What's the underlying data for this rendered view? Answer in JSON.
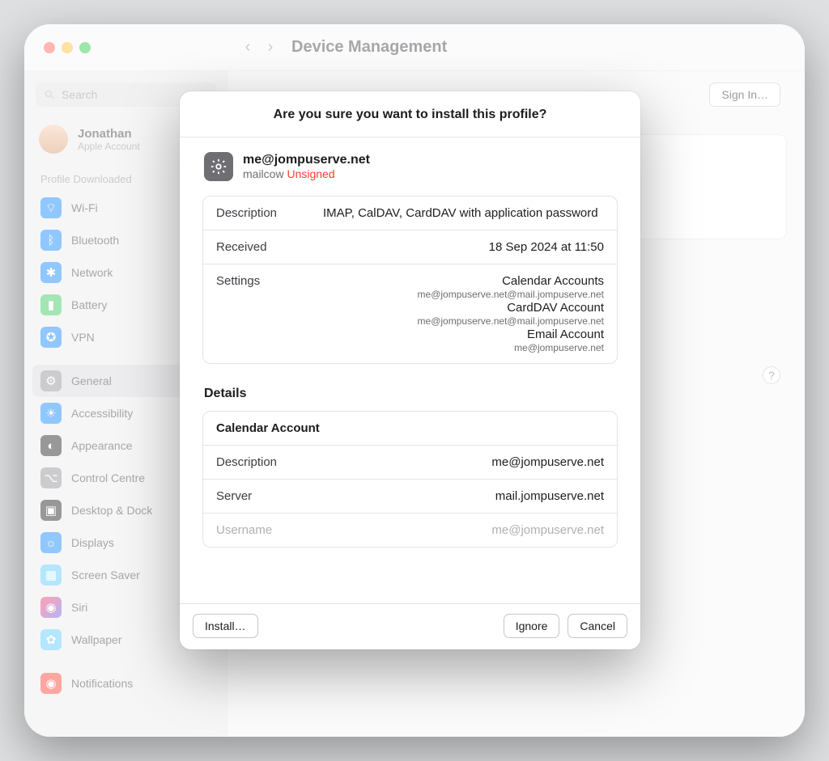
{
  "header": {
    "title": "Device Management",
    "signin": "Sign In…",
    "help": "?"
  },
  "search": {
    "placeholder": "Search"
  },
  "account": {
    "name": "Jonathan",
    "sub": "Apple Account"
  },
  "sidebar": {
    "sectionLabel": "Profile Downloaded",
    "items1": [
      {
        "label": "Wi-Fi",
        "icon": "wifi"
      },
      {
        "label": "Bluetooth",
        "icon": "bt"
      },
      {
        "label": "Network",
        "icon": "net"
      },
      {
        "label": "Battery",
        "icon": "bat"
      },
      {
        "label": "VPN",
        "icon": "vpn"
      }
    ],
    "items2": [
      {
        "label": "General",
        "icon": "gen",
        "selected": true
      },
      {
        "label": "Accessibility",
        "icon": "acc"
      },
      {
        "label": "Appearance",
        "icon": "app"
      },
      {
        "label": "Control Centre",
        "icon": "cc"
      },
      {
        "label": "Desktop & Dock",
        "icon": "dock"
      },
      {
        "label": "Displays",
        "icon": "disp"
      },
      {
        "label": "Screen Saver",
        "icon": "ss"
      },
      {
        "label": "Siri",
        "icon": "siri"
      },
      {
        "label": "Wallpaper",
        "icon": "wall"
      }
    ],
    "items3": [
      {
        "label": "Notifications",
        "icon": "not"
      }
    ]
  },
  "modal": {
    "title": "Are you sure you want to install this profile?",
    "profile": {
      "name": "me@jompuserve.net",
      "source": "mailcow",
      "status": "Unsigned"
    },
    "info": {
      "descriptionLabel": "Description",
      "descriptionValue": "IMAP, CalDAV, CardDAV with application password",
      "receivedLabel": "Received",
      "receivedValue": "18 Sep 2024 at 11:50"
    },
    "settingsLabel": "Settings",
    "settings": [
      {
        "main": "Calendar Accounts",
        "sub": "me@jompuserve.net@mail.jompuserve.net"
      },
      {
        "main": "CardDAV Account",
        "sub": "me@jompuserve.net@mail.jompuserve.net"
      },
      {
        "main": "Email Account",
        "sub": "me@jompuserve.net"
      }
    ],
    "detailsTitle": "Details",
    "detailCard": {
      "title": "Calendar Account",
      "rows": [
        {
          "k": "Description",
          "v": "me@jompuserve.net"
        },
        {
          "k": "Server",
          "v": "mail.jompuserve.net"
        },
        {
          "k": "Username",
          "v": "me@jompuserve.net"
        }
      ]
    },
    "buttons": {
      "install": "Install…",
      "ignore": "Ignore",
      "cancel": "Cancel"
    }
  }
}
